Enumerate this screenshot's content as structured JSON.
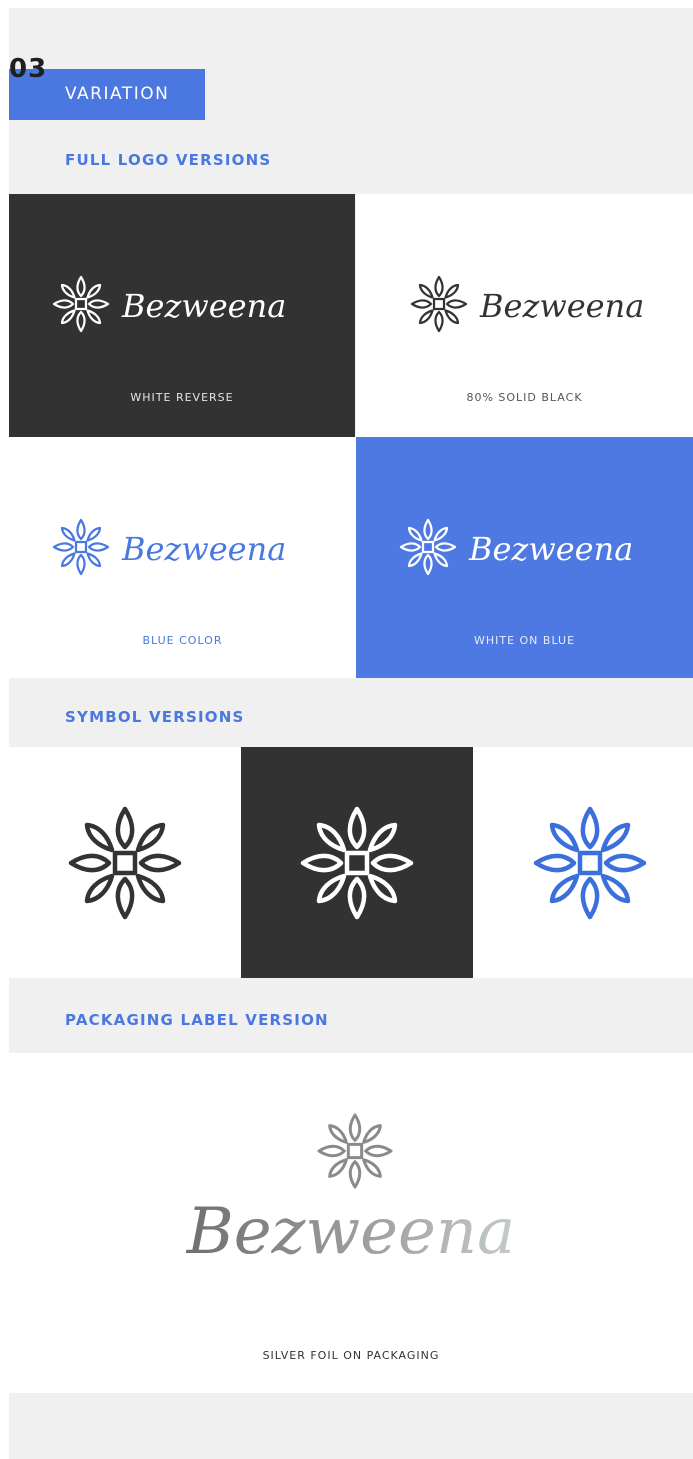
{
  "section": {
    "number": "03",
    "title": "VARIATION"
  },
  "brand": {
    "name": "Bezweena"
  },
  "colors": {
    "accent_blue": "#4a78e0",
    "dark_panel": "#323232",
    "solid_black_80": "#333333",
    "silver": "#8a8a8a",
    "background": "#f0f0f0"
  },
  "full_logo": {
    "heading": "FULL LOGO VERSIONS",
    "versions": [
      {
        "caption": "WHITE REVERSE",
        "background": "#323232",
        "ink": "#ffffff",
        "caption_color": "#e6e6e6"
      },
      {
        "caption": "80% SOLID BLACK",
        "background": "#ffffff",
        "ink": "#333333",
        "caption_color": "#555555"
      },
      {
        "caption": "BLUE COLOR",
        "background": "#ffffff",
        "ink": "#4a78e0",
        "caption_color": "#4a78e0"
      },
      {
        "caption": "WHITE ON BLUE",
        "background": "#4e79e2",
        "ink": "#ffffff",
        "caption_color": "#e6ecfb"
      }
    ]
  },
  "symbols": {
    "heading": "SYMBOL VERSIONS",
    "versions": [
      {
        "icon": "flower-symbol-icon",
        "background": "#ffffff",
        "ink": "#333333"
      },
      {
        "icon": "flower-symbol-icon",
        "background": "#323232",
        "ink": "#ffffff"
      },
      {
        "icon": "flower-symbol-icon",
        "background": "#ffffff",
        "ink": "#3b6fdc"
      }
    ]
  },
  "packaging": {
    "heading": "PACKAGING LABEL VERSION",
    "caption": "SILVER FOIL ON PACKAGING",
    "ink": "#8a8a8a"
  }
}
